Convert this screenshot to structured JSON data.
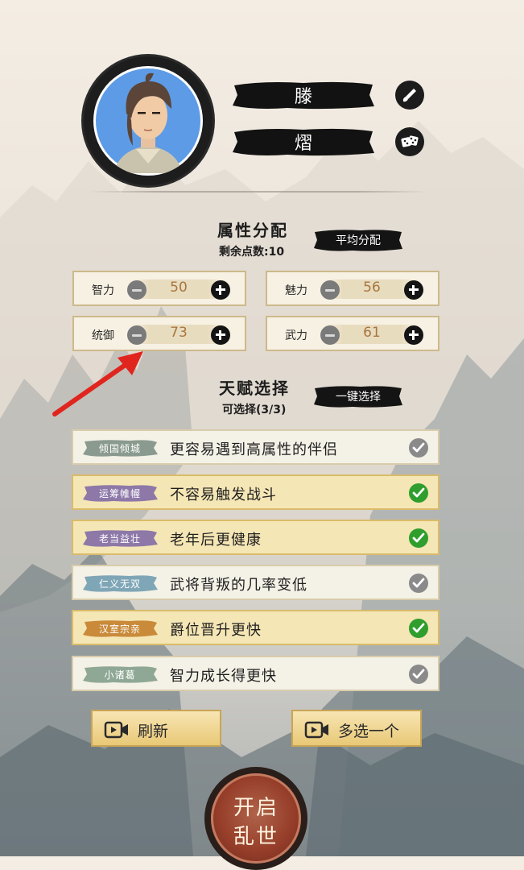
{
  "character": {
    "name_top": "滕",
    "name_bottom": "熠"
  },
  "attributes": {
    "title": "属性分配",
    "remaining_label": "剩余点数:10",
    "average_button": "平均分配",
    "items": [
      {
        "label": "智力",
        "value": "50"
      },
      {
        "label": "魅力",
        "value": "56"
      },
      {
        "label": "统御",
        "value": "73"
      },
      {
        "label": "武力",
        "value": "61"
      }
    ]
  },
  "talents": {
    "title": "天赋选择",
    "selectable_label": "可选择(3/3)",
    "one_click_button": "一键选择",
    "items": [
      {
        "tag": "倾国倾城",
        "desc": "更容易遇到高属性的伴侣",
        "selected": false,
        "tag_color": "#8a9a8e"
      },
      {
        "tag": "运筹帷幄",
        "desc": "不容易触发战斗",
        "selected": true,
        "tag_color": "#8d78a8"
      },
      {
        "tag": "老当益壮",
        "desc": "老年后更健康",
        "selected": true,
        "tag_color": "#8d78a8"
      },
      {
        "tag": "仁义无双",
        "desc": "武将背叛的几率变低",
        "selected": false,
        "tag_color": "#7fa6b6"
      },
      {
        "tag": "汉室宗亲",
        "desc": "爵位晋升更快",
        "selected": true,
        "tag_color": "#c98a3a"
      },
      {
        "tag": "小诸葛",
        "desc": "智力成长得更快",
        "selected": false,
        "tag_color": "#8fa895"
      }
    ]
  },
  "buttons": {
    "refresh": "刷新",
    "pick_one_more": "多选一个",
    "start_line1": "开启",
    "start_line2": "乱世"
  },
  "colors": {
    "accent_gold": "#e9c977",
    "selected_green": "#2f9e2d",
    "start_red": "#963e2a"
  }
}
